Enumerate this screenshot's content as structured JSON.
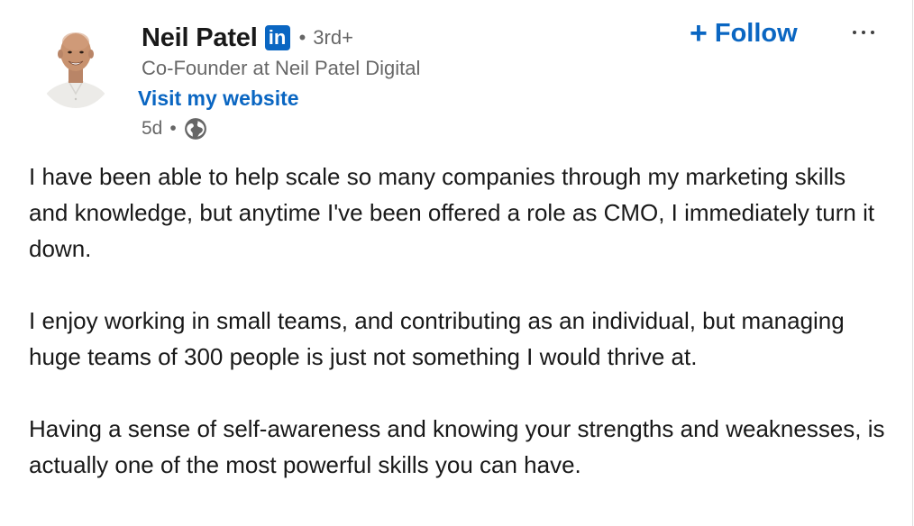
{
  "author": {
    "name": "Neil Patel",
    "badge": "in",
    "connection_separator": "•",
    "connection_degree": "3rd+",
    "headline": "Co-Founder at Neil Patel Digital",
    "website_label": "Visit my website"
  },
  "meta": {
    "time_ago": "5d",
    "separator": "•",
    "visibility_icon": "globe-icon"
  },
  "actions": {
    "follow_label": "Follow",
    "follow_icon": "plus-icon",
    "more_icon": "ellipsis-icon"
  },
  "post": {
    "paragraphs": [
      "I have been able to help scale so many companies through my marketing skills and knowledge, but anytime I've been offered a role as CMO, I immediately turn it down.",
      "I enjoy working in small teams, and contributing as an individual, but managing huge teams of 300 people is just not something I would thrive at.",
      "Having a sense of self-awareness and knowing your strengths and weaknesses, is actually one of the most powerful skills you can have."
    ]
  },
  "colors": {
    "brand": "#0a66c2",
    "text_primary": "rgba(0,0,0,0.9)",
    "text_secondary": "rgba(0,0,0,0.6)"
  }
}
